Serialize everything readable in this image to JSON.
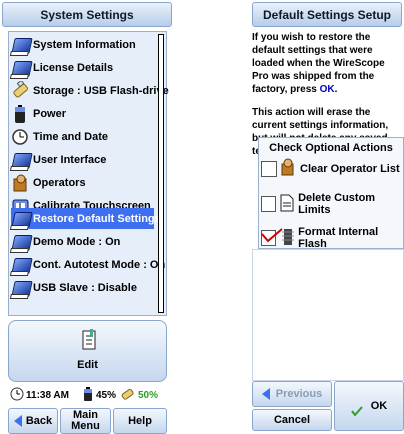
{
  "left": {
    "title": "System Settings",
    "items": [
      {
        "label": "System Information",
        "icon": "book-icon"
      },
      {
        "label": "License Details",
        "icon": "book-icon"
      },
      {
        "label": "Storage : USB Flash-drive",
        "icon": "usb-drive-icon"
      },
      {
        "label": "Power",
        "icon": "battery-icon"
      },
      {
        "label": "Time and Date",
        "icon": "clock-icon"
      },
      {
        "label": "User Interface",
        "icon": "book-icon"
      },
      {
        "label": "Operators",
        "icon": "operator-icon"
      },
      {
        "label": "Calibrate Touchscreen",
        "icon": "touchscreen-icon"
      },
      {
        "label": "Restore Default Settings",
        "icon": "book-icon",
        "selected": true
      },
      {
        "label": "Demo Mode : On",
        "icon": "book-icon"
      },
      {
        "label": "Cont. Autotest Mode : On",
        "icon": "book-icon"
      },
      {
        "label": "USB Slave : Disable",
        "icon": "book-icon"
      }
    ],
    "edit_label": "Edit",
    "status": {
      "time": "11:38 AM",
      "battery": "45%",
      "storage": "50%",
      "storage_color": "#2aa02a"
    },
    "buttons": {
      "back": "Back",
      "main_menu": "Main Menu",
      "help": "Help"
    }
  },
  "right": {
    "title": "Default Settings Setup",
    "para1_a": "If you wish to restore the default settings that were loaded when the WireScope Pro was shipped from the factory, press ",
    "para1_ok": "OK",
    "para1_b": ".",
    "para2": "This action will erase the current settings information, but will not delete any saved test results.",
    "options_header": "Check Optional Actions",
    "options": [
      {
        "label": "Clear Operator List",
        "checked": false,
        "icon": "operator-icon"
      },
      {
        "label": "Delete Custom Limits",
        "checked": false,
        "icon": "document-icon"
      },
      {
        "label": "Format Internal Flash",
        "checked": true,
        "icon": "flash-chip-icon"
      }
    ],
    "buttons": {
      "previous": "Previous",
      "cancel": "Cancel",
      "ok": "OK"
    },
    "accent": "#0000cc"
  }
}
